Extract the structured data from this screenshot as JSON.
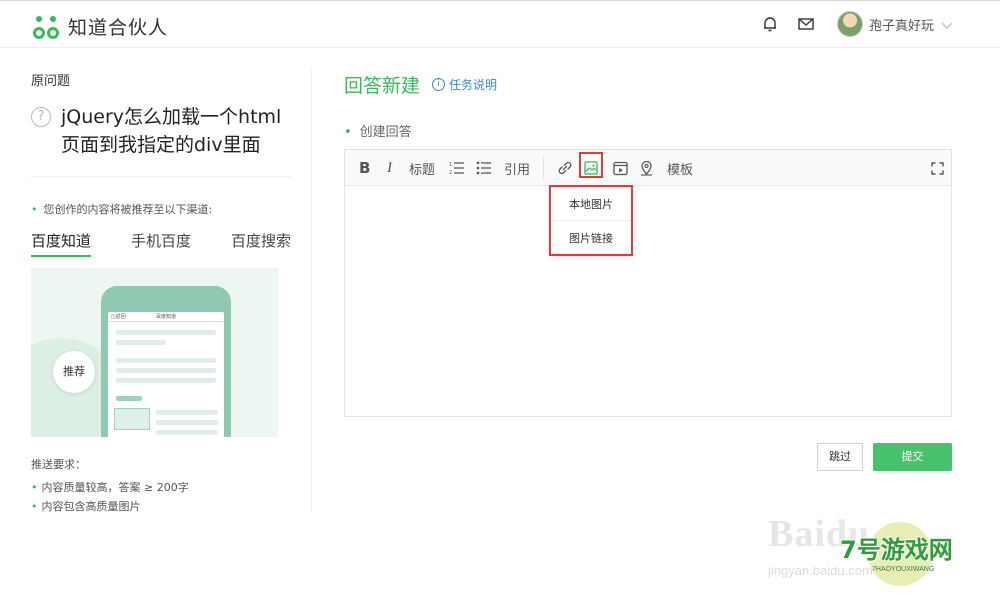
{
  "header": {
    "brand": "知道合伙人",
    "username": "孢子真好玩",
    "icons": [
      "bell-icon",
      "mail-icon",
      "chevron-down-icon"
    ]
  },
  "left": {
    "question_caption": "原问题",
    "question_mark": "?",
    "question_title_line1": "jQuery怎么加载一个html",
    "question_title_line2": "页面到我指定的div里面",
    "rec_note": "您创作的内容将被推荐至以下渠道:",
    "channels": [
      "百度知道",
      "手机百度",
      "百度搜索"
    ],
    "promo": {
      "phone_header_left": "◫返回",
      "phone_header_center": "百度知道",
      "recommend_badge": "推荐"
    },
    "requirements_title": "推送要求：",
    "requirements": [
      "内容质量较高，答案 ≥ 200字",
      "内容包含高质量图片"
    ]
  },
  "main": {
    "title": "回答新建",
    "task_link": "任务说明",
    "create_label": "创建回答",
    "toolbar": {
      "bold": "B",
      "italic": "I",
      "heading": "标题",
      "quote": "引用",
      "template": "模板"
    },
    "image_menu": [
      "本地图片",
      "图片链接"
    ],
    "buttons": {
      "skip": "跳过",
      "submit": "提交"
    }
  },
  "watermark": {
    "baidu": "Baidu",
    "jingyan": "jingyan.baidu.com",
    "site": "7号游戏网",
    "site_sub": "7HAOYOUXIWANG"
  },
  "colors": {
    "accent": "#38b95a",
    "submit": "#45c26a",
    "highlight": "#e03a3a",
    "link": "#3a86c8"
  }
}
